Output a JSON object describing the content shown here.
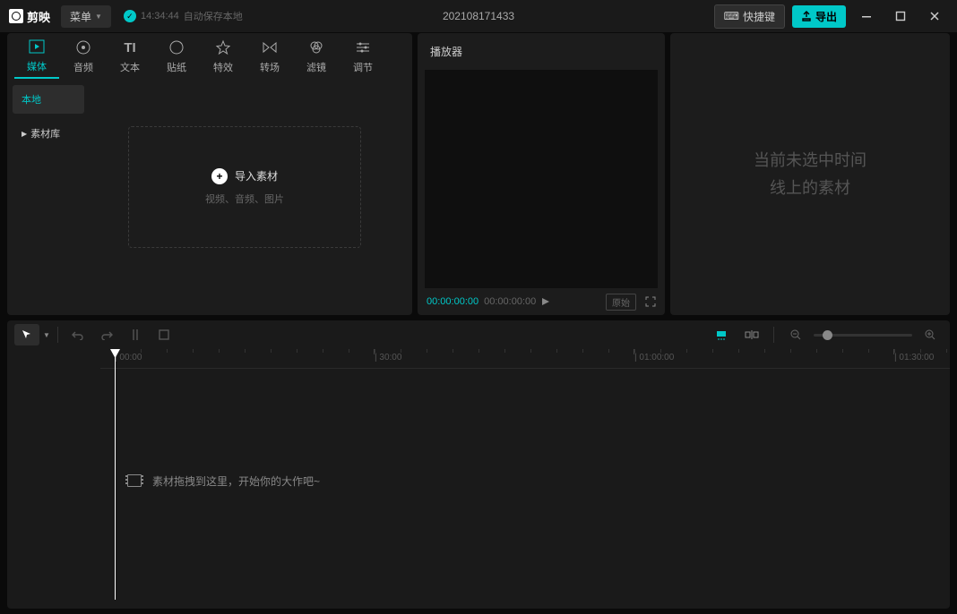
{
  "titlebar": {
    "app_name": "剪映",
    "menu_label": "菜单",
    "autosave_time": "14:34:44",
    "autosave_text": "自动保存本地",
    "project_title": "202108171433",
    "shortcut_label": "快捷键",
    "export_label": "导出"
  },
  "tabs": [
    {
      "label": "媒体",
      "icon": "media-icon"
    },
    {
      "label": "音频",
      "icon": "audio-icon"
    },
    {
      "label": "文本",
      "icon": "text-icon"
    },
    {
      "label": "贴纸",
      "icon": "sticker-icon"
    },
    {
      "label": "特效",
      "icon": "effects-icon"
    },
    {
      "label": "转场",
      "icon": "transition-icon"
    },
    {
      "label": "滤镜",
      "icon": "filter-icon"
    },
    {
      "label": "调节",
      "icon": "adjust-icon"
    }
  ],
  "sidebar": {
    "items": [
      {
        "label": "本地"
      },
      {
        "label": "素材库"
      }
    ]
  },
  "import": {
    "title": "导入素材",
    "subtitle": "视频、音频、图片"
  },
  "player": {
    "title": "播放器",
    "current_tc": "00:00:00:00",
    "total_tc": "00:00:00:00",
    "ratio_label": "原始"
  },
  "inspector": {
    "empty_line1": "当前未选中时间",
    "empty_line2": "线上的素材"
  },
  "timeline": {
    "hint": "素材拖拽到这里，开始你的大作吧~",
    "ticks": [
      {
        "label": "00:00",
        "pos": 0
      },
      {
        "label": "30:00",
        "pos": 290
      },
      {
        "label": "01:00:00",
        "pos": 580
      },
      {
        "label": "01:30:00",
        "pos": 870
      }
    ]
  }
}
